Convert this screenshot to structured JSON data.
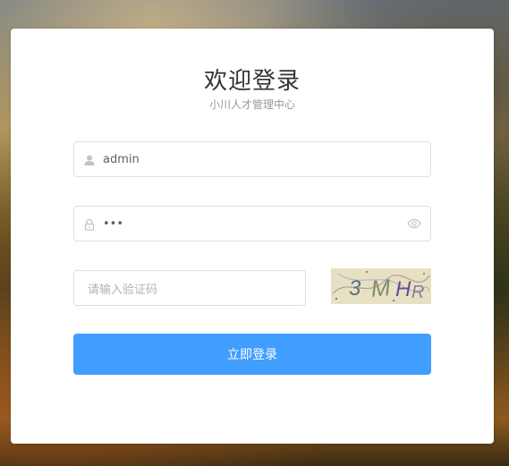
{
  "header": {
    "title": "欢迎登录",
    "subtitle": "小川人才管理中心"
  },
  "form": {
    "username": {
      "value": "admin",
      "icon": "user-icon"
    },
    "password": {
      "value": "•••",
      "icon": "lock-icon",
      "toggle_icon": "eye-icon"
    },
    "captcha_input": {
      "placeholder": "请输入验证码"
    },
    "captcha_image": {
      "text": "3MHR"
    },
    "submit_label": "立即登录"
  },
  "colors": {
    "accent": "#409eff",
    "border": "#dcdfe6",
    "card": "#ffffff"
  }
}
